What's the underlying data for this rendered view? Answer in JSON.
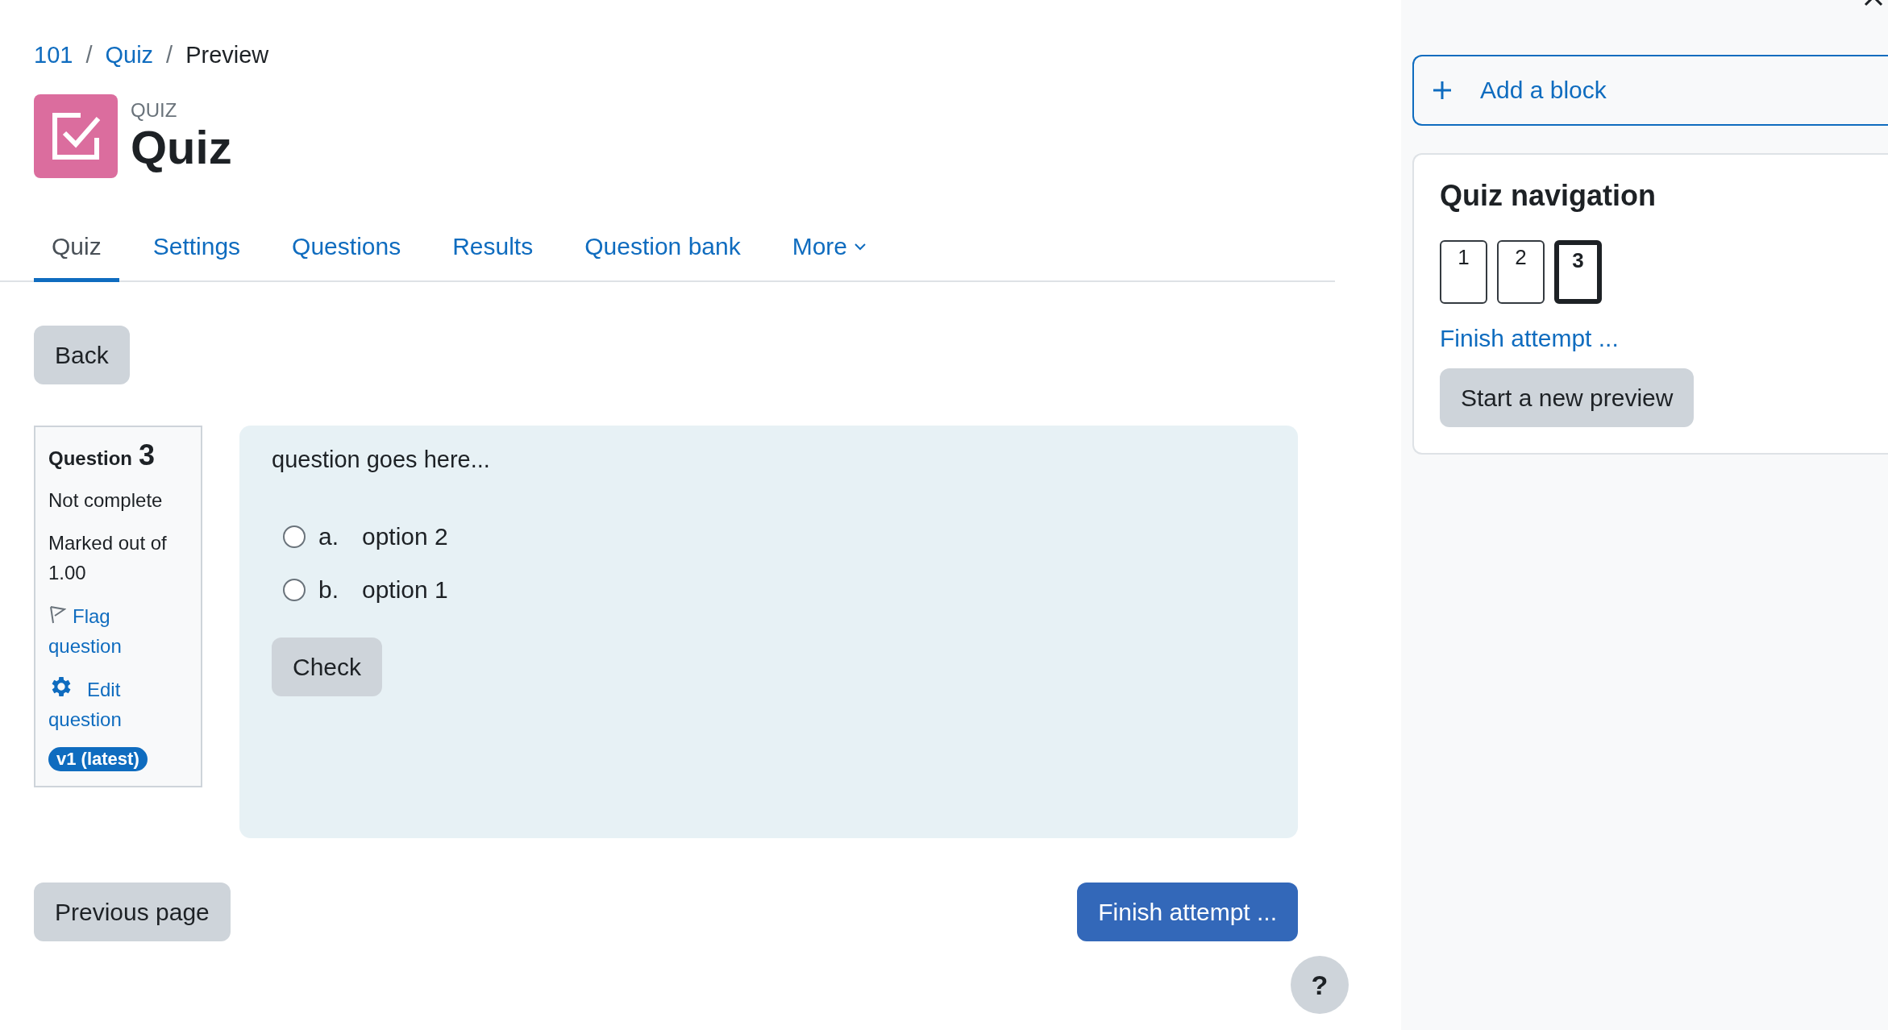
{
  "breadcrumb": [
    {
      "label": "101",
      "kind": "link"
    },
    {
      "label": "/",
      "kind": "separator"
    },
    {
      "label": "Quiz",
      "kind": "link"
    },
    {
      "label": "/",
      "kind": "separator"
    },
    {
      "label": "Preview",
      "kind": "current"
    }
  ],
  "header": {
    "module_type": "QUIZ",
    "title": "Quiz"
  },
  "tabs": [
    {
      "label": "Quiz",
      "selected": true,
      "has_menu": false
    },
    {
      "label": "Settings",
      "selected": false,
      "has_menu": false
    },
    {
      "label": "Questions",
      "selected": false,
      "has_menu": false
    },
    {
      "label": "Results",
      "selected": false,
      "has_menu": false
    },
    {
      "label": "Question bank",
      "selected": false,
      "has_menu": false
    },
    {
      "label": "More",
      "selected": false,
      "has_menu": true
    }
  ],
  "back_button": "Back",
  "question_info": {
    "label": "Question",
    "number": "3",
    "state": "Not complete",
    "mark": "Marked out of 1.00",
    "flag_link": "Flag question",
    "flagged": false,
    "edit_link": "Edit question",
    "version": "v1 (latest)"
  },
  "question": {
    "text": "question goes here...",
    "options": [
      {
        "letter": "a.",
        "text": "option 2",
        "selected": false
      },
      {
        "letter": "b.",
        "text": "option 1",
        "selected": false
      }
    ],
    "check_button": "Check"
  },
  "footer": {
    "previous_button": "Previous page",
    "finish_button": "Finish attempt ...",
    "help_button": "?"
  },
  "drawer": {
    "add_block": "Add a block",
    "navigation": {
      "title": "Quiz navigation",
      "questions": [
        {
          "number": "1",
          "selected": false
        },
        {
          "number": "2",
          "selected": false
        },
        {
          "number": "3",
          "selected": true
        }
      ],
      "finish_link": "Finish attempt ...",
      "new_preview_button": "Start a new preview"
    }
  }
}
